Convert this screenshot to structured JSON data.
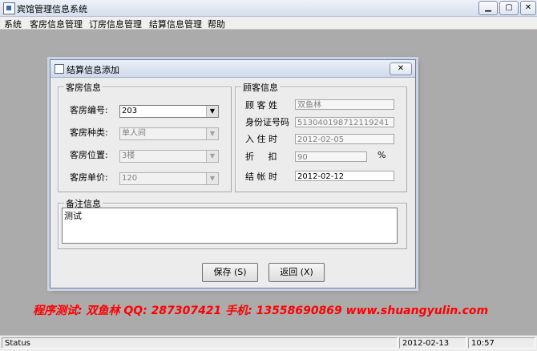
{
  "app": {
    "title": "宾馆管理信息系统",
    "controls": {
      "minimize": "▁",
      "maximize": "▢",
      "close": "✕"
    }
  },
  "menu": [
    "系统",
    "客房信息管理",
    "订房信息管理",
    "结算信息管理",
    "帮助"
  ],
  "dialog": {
    "title": "结算信息添加",
    "close": "✕",
    "room_group": {
      "title": "客房信息",
      "fields": [
        {
          "label": "客房编号:",
          "value": "203",
          "enabled": true
        },
        {
          "label": "客房种类:",
          "value": "单人间",
          "enabled": false
        },
        {
          "label": "客房位置:",
          "value": "3楼",
          "enabled": false
        },
        {
          "label": "客房单价:",
          "value": "120",
          "enabled": false
        }
      ]
    },
    "guest_group": {
      "title": "顾客信息",
      "fields": [
        {
          "label": "顾 客 姓",
          "value": "双鱼林",
          "enabled": false
        },
        {
          "label": "身份证号码",
          "value": "513040198712119241",
          "enabled": false
        },
        {
          "label": "入 住 时",
          "value": "2012-02-05",
          "enabled": false
        },
        {
          "label": "折     扣",
          "value": "90",
          "enabled": false,
          "suffix": "%"
        },
        {
          "label": "结 帐 时",
          "value": "2012-02-12",
          "enabled": true
        }
      ]
    },
    "notes_group": {
      "title": "备注信息",
      "value": "测试"
    },
    "buttons": {
      "save": "保存 (S)",
      "back": "返回 (X)"
    }
  },
  "banner": "程序测试: 双鱼林   QQ: 287307421   手机: 13558690869   www.shuangyulin.com",
  "status": {
    "label": "Status",
    "date": "2012-02-13",
    "time": "10:57"
  },
  "colors": {
    "banner": "#ff0000",
    "desktop": "#ababab"
  }
}
